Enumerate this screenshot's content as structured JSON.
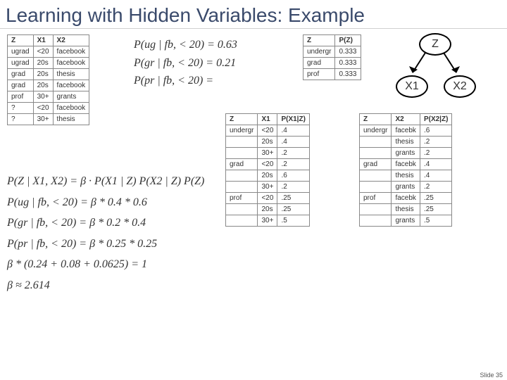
{
  "title": "Learning with Hidden Variables: Example",
  "slide_number": "Slide 35",
  "nodes": {
    "z": "Z",
    "x1": "X1",
    "x2": "X2"
  },
  "data_table": {
    "headers": [
      "Z",
      "X1",
      "X2"
    ],
    "rows": [
      [
        "ugrad",
        "<20",
        "facebook"
      ],
      [
        "ugrad",
        "20s",
        "facebook"
      ],
      [
        "grad",
        "20s",
        "thesis"
      ],
      [
        "grad",
        "20s",
        "facebook"
      ],
      [
        "prof",
        "30+",
        "grants"
      ],
      [
        "?",
        "<20",
        "facebook"
      ],
      [
        "?",
        "30+",
        "thesis"
      ]
    ]
  },
  "formulas_top": [
    "P(ug | fb, < 20) = 0.63",
    "P(gr | fb, < 20) = 0.21",
    "P(pr | fb, < 20) = "
  ],
  "formulas_bottom": [
    "P(Z | X1, X2) = β · P(X1 | Z) P(X2 | Z) P(Z)",
    "P(ug | fb, < 20) = β * 0.4 * 0.6",
    "P(gr | fb, < 20) = β * 0.2 * 0.4",
    "P(pr | fb, < 20) = β * 0.25 * 0.25",
    "β * (0.24 + 0.08 + 0.0625) = 1",
    "β ≈ 2.614"
  ],
  "pz_table": {
    "headers": [
      "Z",
      "P(Z)"
    ],
    "rows": [
      [
        "undergr",
        "0.333"
      ],
      [
        "grad",
        "0.333"
      ],
      [
        "prof",
        "0.333"
      ]
    ]
  },
  "px1z_table": {
    "headers": [
      "Z",
      "X1",
      "P(X1|Z)"
    ],
    "rows": [
      [
        "undergr",
        "<20",
        ".4"
      ],
      [
        "",
        "20s",
        ".4"
      ],
      [
        "",
        "30+",
        ".2"
      ],
      [
        "grad",
        "<20",
        ".2"
      ],
      [
        "",
        "20s",
        ".6"
      ],
      [
        "",
        "30+",
        ".2"
      ],
      [
        "prof",
        "<20",
        ".25"
      ],
      [
        "",
        "20s",
        ".25"
      ],
      [
        "",
        "30+",
        ".5"
      ]
    ]
  },
  "px2z_table": {
    "headers": [
      "Z",
      "X2",
      "P(X2|Z)"
    ],
    "rows": [
      [
        "undergr",
        "facebk",
        ".6"
      ],
      [
        "",
        "thesis",
        ".2"
      ],
      [
        "",
        "grants",
        ".2"
      ],
      [
        "grad",
        "facebk",
        ".4"
      ],
      [
        "",
        "thesis",
        ".4"
      ],
      [
        "",
        "grants",
        ".2"
      ],
      [
        "prof",
        "facebk",
        ".25"
      ],
      [
        "",
        "thesis",
        ".25"
      ],
      [
        "",
        "grants",
        ".5"
      ]
    ]
  }
}
